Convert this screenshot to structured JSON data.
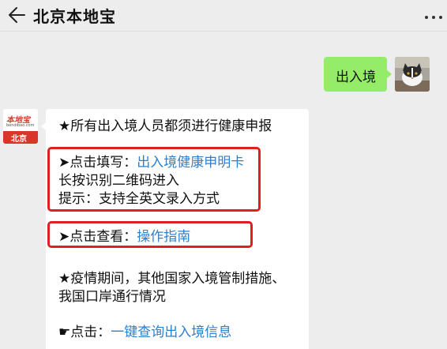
{
  "header": {
    "title": "北京本地宝"
  },
  "messages": {
    "outgoing": {
      "text": "出入境"
    },
    "incoming": {
      "avatar_logo": "本地宝",
      "avatar_site": "bendibao.com",
      "avatar_city": "北京",
      "line1": "★所有出入境人员都须进行健康申报",
      "fill_prefix": "➤点击填写：",
      "fill_link": "出入境健康申明卡",
      "scan_note": "长按识别二维码进入",
      "tip_note": "提示：支持全英文录入方式",
      "view_prefix": "➤点击查看：",
      "view_link": "操作指南",
      "epidemic_line1": "★疫情期间，其他国家入境管制措施、",
      "epidemic_line2": "我国口岸通行情况",
      "query_prefix": "☛点击：",
      "query_link": "一键查询出入境信息"
    }
  },
  "colors": {
    "outgoing_bubble": "#95ec69",
    "link": "#2f7fca",
    "highlight": "#e02020",
    "background": "#ededed"
  },
  "icons": {
    "back": "arrow-left-icon",
    "more": "more-dots-icon"
  }
}
